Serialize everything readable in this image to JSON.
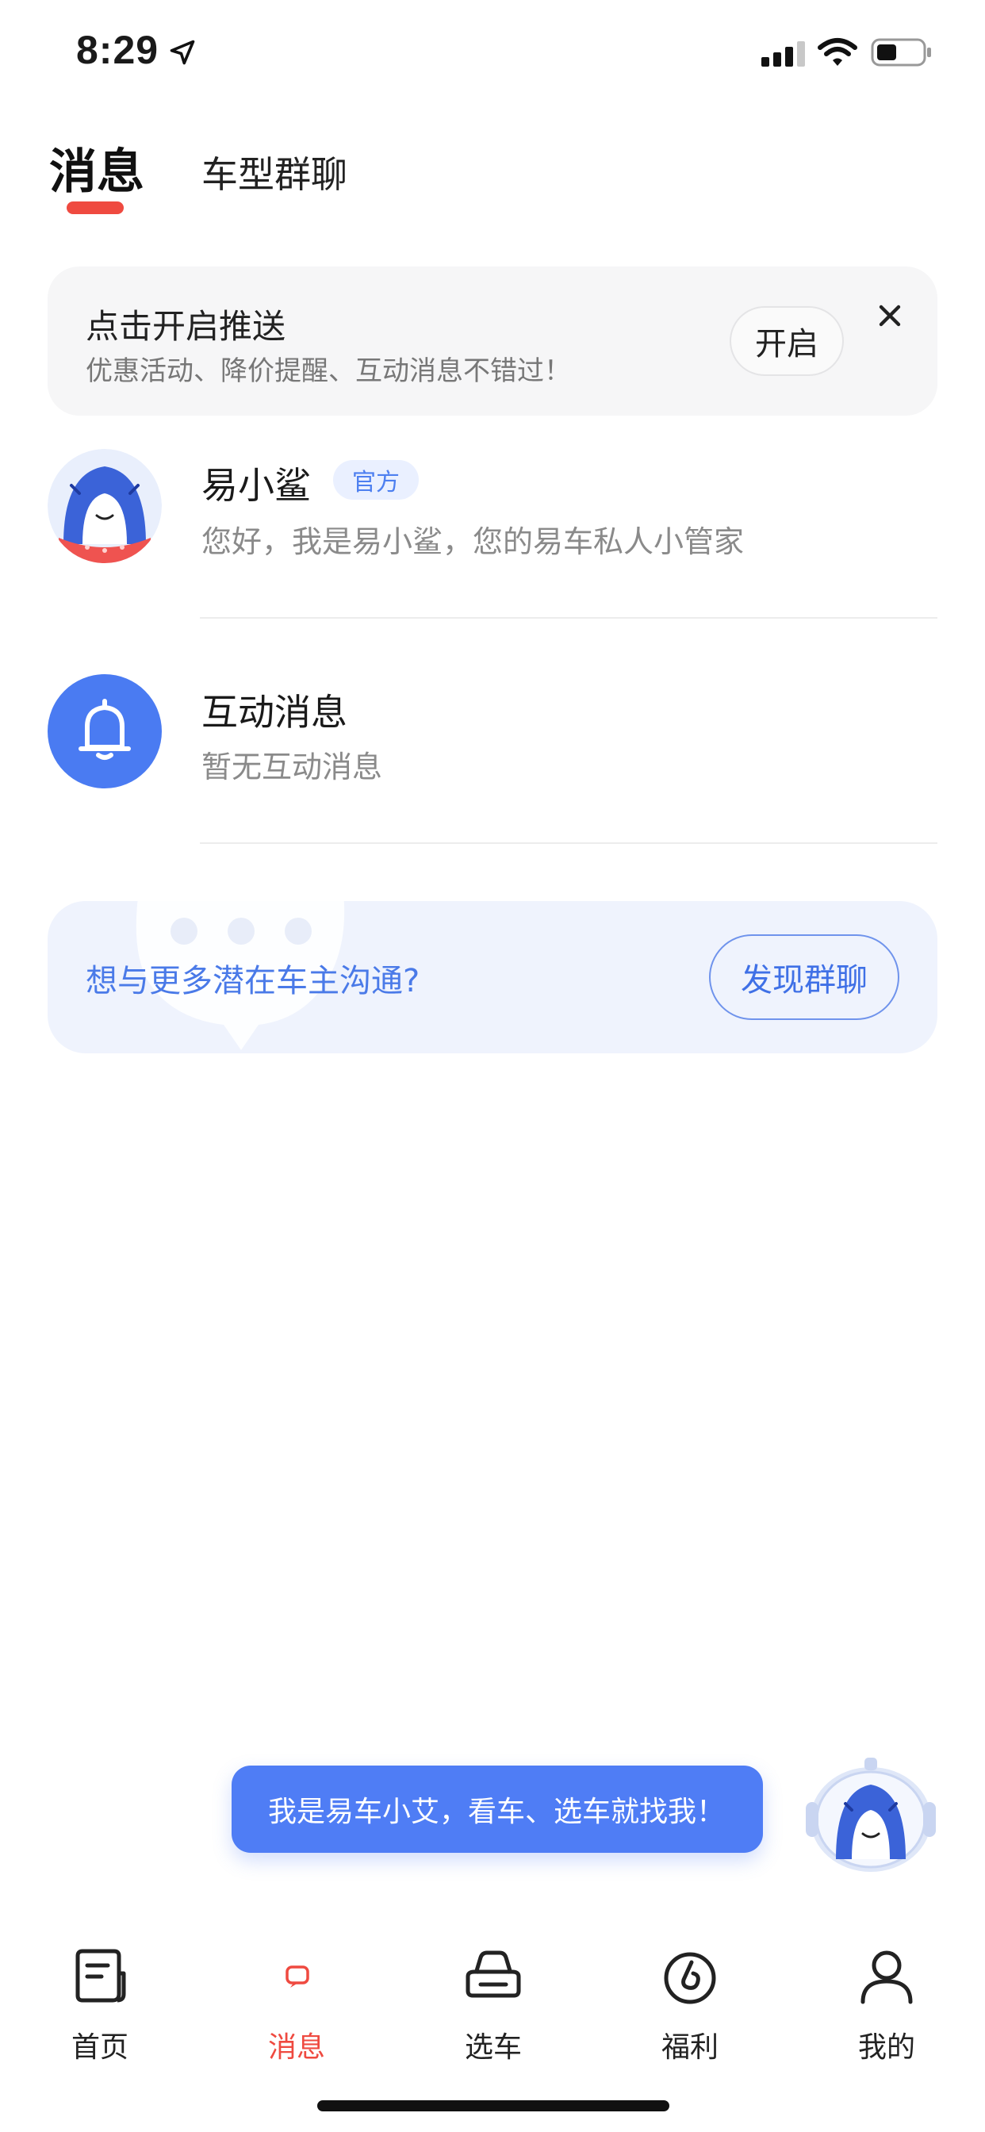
{
  "status_bar": {
    "time": "8:29"
  },
  "tabs": [
    {
      "label": "消息",
      "active": true
    },
    {
      "label": "车型群聊",
      "active": false
    }
  ],
  "push_banner": {
    "title": "点击开启推送",
    "subtitle": "优惠活动、降价提醒、互动消息不错过！",
    "button_label": "开启"
  },
  "messages": [
    {
      "name": "易小鲨",
      "badge": "官方",
      "preview": "您好，我是易小鲨，您的易车私人小管家"
    },
    {
      "name": "互动消息",
      "preview": "暂无互动消息"
    }
  ],
  "discover": {
    "text": "想与更多潜在车主沟通?",
    "button_label": "发现群聊"
  },
  "assistant": {
    "bubble_text": "我是易车小艾，看车、选车就找我！"
  },
  "bottom_nav": [
    {
      "label": "首页",
      "icon": "home-icon",
      "active": false
    },
    {
      "label": "消息",
      "icon": "message-icon",
      "active": true
    },
    {
      "label": "选车",
      "icon": "car-icon",
      "active": false
    },
    {
      "label": "福利",
      "icon": "welfare-icon",
      "active": false
    },
    {
      "label": "我的",
      "icon": "profile-icon",
      "active": false
    }
  ],
  "colors": {
    "accent_red": "#ef4a40",
    "brand_blue": "#4f7df5",
    "banner_bg": "#f6f6f7",
    "discover_bg": "#eff3fd"
  }
}
